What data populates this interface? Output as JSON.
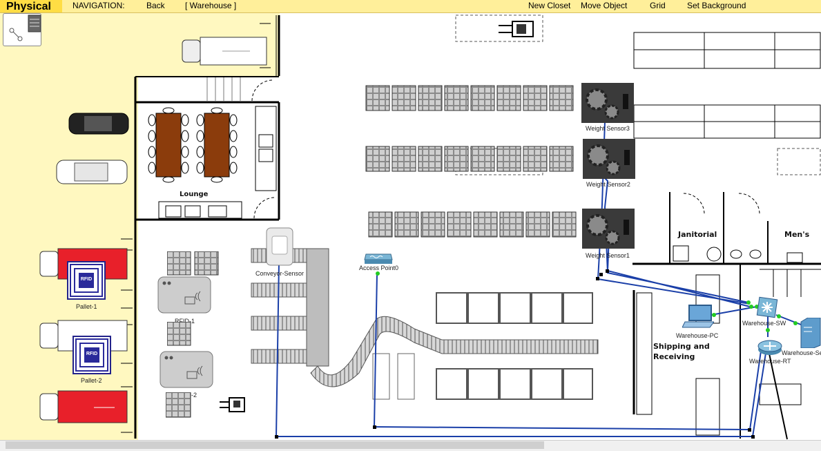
{
  "toolbar": {
    "title": "Physical",
    "nav_label": "NAVIGATION:",
    "back": "Back",
    "location": "[ Warehouse ]",
    "new_closet": "New Closet",
    "move_object": "Move Object",
    "grid": "Grid",
    "set_background": "Set Background"
  },
  "rooms": {
    "lounge": "Lounge",
    "janitorial": "Janitorial",
    "mens": "Men's",
    "shipping": "Shipping and Receiving"
  },
  "devices": {
    "weight_sensor3": "Weight Sensor3",
    "weight_sensor2": "Weight Sensor2",
    "weight_sensor1": "Weight Sensor1",
    "conveyor_sensor": "Conveyor-Sensor",
    "access_point": "Access Point0",
    "warehouse_pc": "Warehouse-PC",
    "warehouse_sw": "Warehouse-SW",
    "warehouse_rt": "Warehouse-RT",
    "warehouse_server": "Warehouse-Se",
    "rfid1": "RFID-1",
    "rfid2": "RFID-2",
    "pallet1": "Pallet-1",
    "pallet2": "Pallet-2",
    "rfid_tag": "RFID"
  },
  "colors": {
    "toolbar": "#ffef9a",
    "title_bg": "#ffdd44",
    "cable": "#1a3fa8",
    "link_led": "#22cc22",
    "red_truck": "#e8202a",
    "table_wood": "#8b3c0c"
  }
}
